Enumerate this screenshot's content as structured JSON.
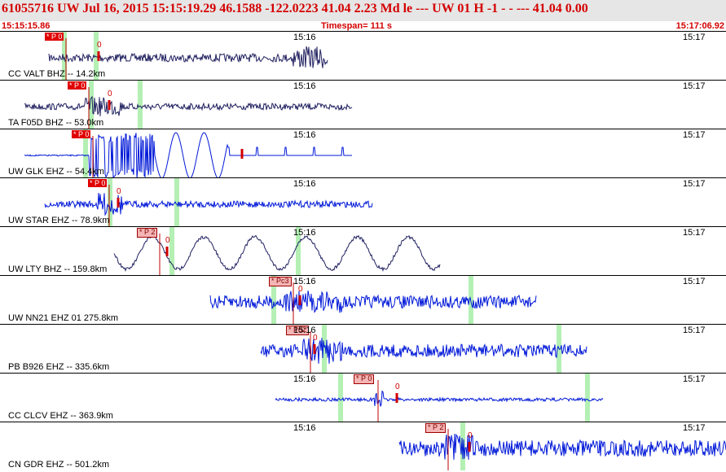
{
  "header": {
    "title": "61055716 UW Jul 16, 2015 15:15:19.29   46.1588 -122.0223 41.04 2.23 Md le    ---      UW 01 H   -1   -  - --- 41.04 0.00",
    "start_time": "15:15:15.86",
    "timespan": "Timespan= 111 s",
    "end_time": "15:17:06.92"
  },
  "colors": {
    "header_bg": "#e6e6e6",
    "header_text": "#d40000",
    "trace_navy": "#202060",
    "trace_blue": "#0018d8",
    "pick_auto": "#e00000",
    "pick_manual_bg": "#f4b5b5",
    "coda_marker": "#b4f0b4"
  },
  "channels": [
    {
      "label": "CC VALT BHZ -- 14.2km",
      "pick": "P 0",
      "pick_style": "auto",
      "tick1": "15:16",
      "tick2": "15:17",
      "zero": "0"
    },
    {
      "label": "TA F05D BHZ -- 53.0km",
      "pick": "P 0",
      "pick_style": "auto",
      "tick1": "15:16",
      "tick2": "15:17",
      "zero": "0"
    },
    {
      "label": "UW GLK EHZ -- 54.4km",
      "pick": "P 0",
      "pick_style": "auto",
      "tick1": "15:16",
      "tick2": "15:17",
      "zero": ""
    },
    {
      "label": "UW STAR EHZ -- 78.9km",
      "pick": "P 0",
      "pick_style": "auto",
      "tick1": "15:16",
      "tick2": "15:17",
      "zero": "0"
    },
    {
      "label": "UW LTY BHZ -- 159.8km",
      "pick": "P 2",
      "pick_style": "manual",
      "tick1": "15:16",
      "tick2": "15:17",
      "zero": "0"
    },
    {
      "label": "UW NN21 EHZ 01 275.8km",
      "pick": "Pc3",
      "pick_style": "manual",
      "tick1": "15:16",
      "tick2": "15:17",
      "zero": "0"
    },
    {
      "label": "PB B926 EHZ -- 335.6km",
      "pick": "Pd2",
      "pick_style": "manual",
      "tick1": "15:16",
      "tick2": "15:17",
      "zero": "0"
    },
    {
      "label": "CC CLCV EHZ -- 363.9km",
      "pick": "P 0",
      "pick_style": "manual",
      "tick1": "15:16",
      "tick2": "15:17",
      "zero": "0"
    },
    {
      "label": "CN GDR EHZ -- 501.2km",
      "pick": "P 2",
      "pick_style": "manual",
      "tick1": "15:16",
      "tick2": "15:17",
      "zero": "0"
    }
  ]
}
